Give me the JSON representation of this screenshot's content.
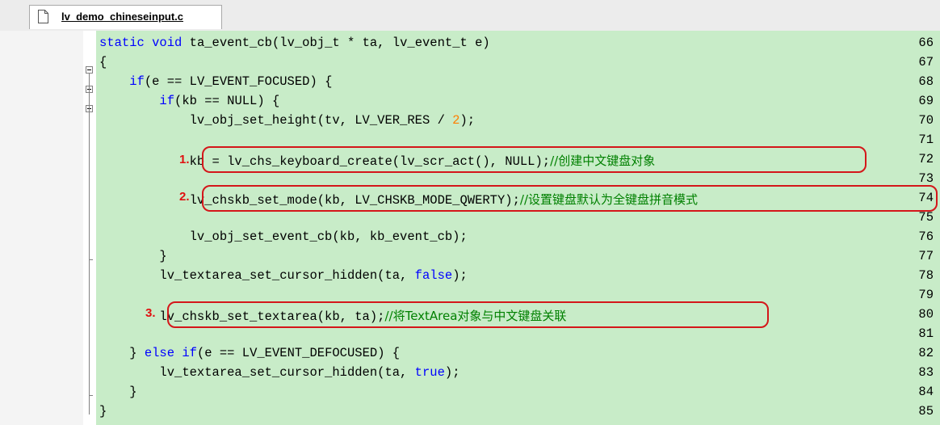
{
  "tab": {
    "title": "lv_demo_chineseinput.c",
    "icon": "file-icon"
  },
  "markers": [
    "1.",
    "2.",
    "3."
  ],
  "lines": [
    {
      "num": "66",
      "html": "<span class=\"kw\">static</span> <span class=\"kw\">void</span> ta_event_cb(lv_obj_t * ta, lv_event_t e)"
    },
    {
      "num": "67",
      "html": "{"
    },
    {
      "num": "68",
      "html": "    <span class=\"kw\">if</span>(e == LV_EVENT_FOCUSED) {"
    },
    {
      "num": "69",
      "html": "        <span class=\"kw\">if</span>(kb == NULL) {"
    },
    {
      "num": "70",
      "html": "            lv_obj_set_height(tv, LV_VER_RES / <span class=\"num\">2</span>);"
    },
    {
      "num": "71",
      "html": ""
    },
    {
      "num": "72",
      "html": "            kb = lv_chs_keyboard_create(lv_scr_act(), NULL);<span class=\"cm\">//创建中文键盘对象</span>"
    },
    {
      "num": "73",
      "html": ""
    },
    {
      "num": "74",
      "html": "            lv_chskb_set_mode(kb, LV_CHSKB_MODE_QWERTY);<span class=\"cm\">//设置键盘默认为全键盘拼音模式</span>"
    },
    {
      "num": "75",
      "html": ""
    },
    {
      "num": "76",
      "html": "            lv_obj_set_event_cb(kb, kb_event_cb);"
    },
    {
      "num": "77",
      "html": "        }"
    },
    {
      "num": "78",
      "html": "        lv_textarea_set_cursor_hidden(ta, <span class=\"kw\">false</span>);"
    },
    {
      "num": "79",
      "html": ""
    },
    {
      "num": "80",
      "html": "        lv_chskb_set_textarea(kb, ta);<span class=\"cm\">//将TextArea对象与中文键盘关联</span>"
    },
    {
      "num": "81",
      "html": ""
    },
    {
      "num": "82",
      "html": "    } <span class=\"kw\">else</span> <span class=\"kw\">if</span>(e == LV_EVENT_DEFOCUSED) {"
    },
    {
      "num": "83",
      "html": "        lv_textarea_set_cursor_hidden(ta, <span class=\"kw\">true</span>);"
    },
    {
      "num": "84",
      "html": "    }"
    },
    {
      "num": "85",
      "html": "}"
    }
  ]
}
